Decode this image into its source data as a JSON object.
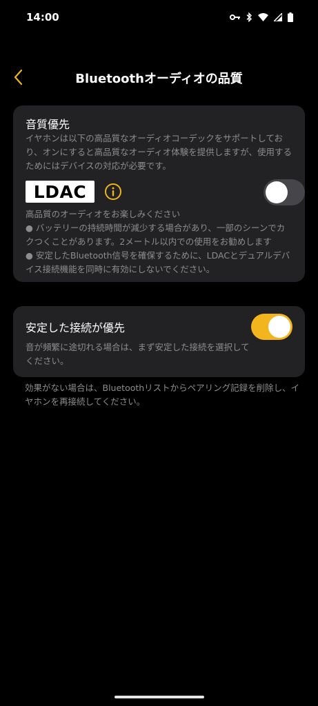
{
  "status_bar": {
    "time": "14:00",
    "icons": [
      "key-icon",
      "bluetooth-icon",
      "wifi-icon",
      "cellular-signal-icon",
      "battery-icon"
    ]
  },
  "header": {
    "title": "Bluetoothオーディオの品質",
    "back_icon": "chevron-left-icon"
  },
  "colors": {
    "accent": "#f3b51d",
    "card_bg": "#222224",
    "secondary_text": "#8d8d90",
    "toggle_off": "#46464a"
  },
  "audio_quality_card": {
    "title": "音質優先",
    "description": "イヤホンは以下の高品質なオーディオコーデックをサポートしており、オンにすると高品質なオーディオ体験を提供しますが、使用するためにはデバイスの対応が必要です。",
    "logo_text": "LDAC",
    "info_icon": "info-icon",
    "toggle_on": false,
    "details": [
      "高品質のオーディオをお楽しみください",
      "● バッテリーの持続時間が減少する場合があり、一部のシーンでカクつくことがあります。2メートル以内での使用をお勧めします",
      "● 安定したBluetooth信号を確保するために、LDACとデュアルデバイス接続機能を同時に有効にしないでください。"
    ]
  },
  "stable_connection_card": {
    "title": "安定した接続が優先",
    "description": "音が頻繁に途切れる場合は、まず安定した接続を選択してください。",
    "toggle_on": true
  },
  "footer_note": "効果がない場合は、Bluetoothリストからペアリング記録を削除し、イヤホンを再接続してください。"
}
